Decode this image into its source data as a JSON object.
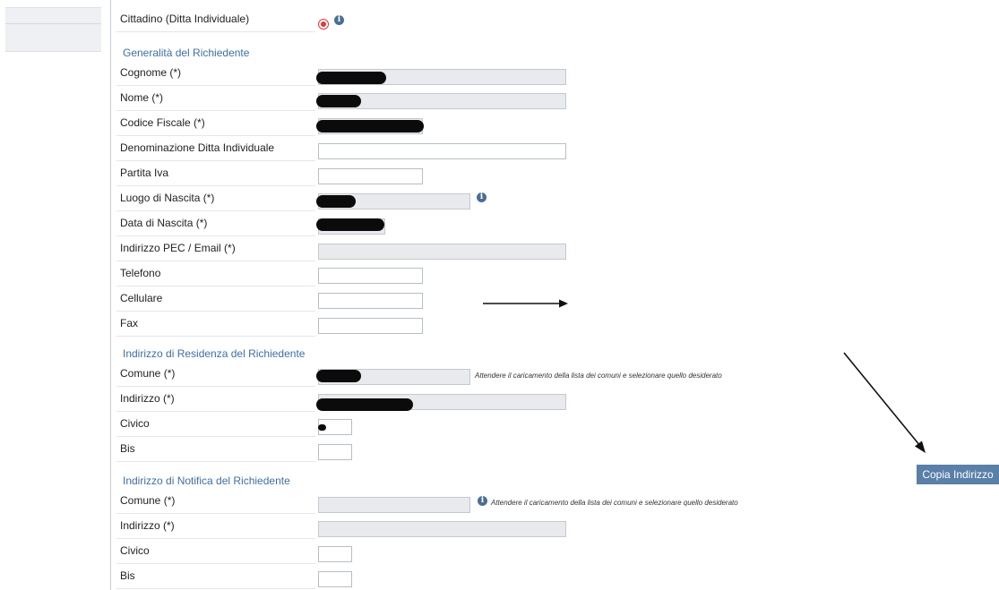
{
  "top_row": {
    "label": "Cittadino (Ditta Individuale)",
    "radio_selected": true
  },
  "sections": {
    "generalita": "Generalità del Richiedente",
    "residenza": "Indirizzo di Residenza del Richiedente",
    "notifica": "Indirizzo di Notifica del Richiedente"
  },
  "generalita_fields": [
    {
      "label": "Cognome (*)",
      "readonly": true,
      "redacted": true
    },
    {
      "label": "Nome (*)",
      "readonly": true,
      "redacted": true
    },
    {
      "label": "Codice Fiscale (*)",
      "readonly": true,
      "redacted": true
    },
    {
      "label": "Denominazione Ditta Individuale",
      "readonly": false,
      "value": ""
    },
    {
      "label": "Partita Iva",
      "readonly": false,
      "value": ""
    },
    {
      "label": "Luogo di Nascita (*)",
      "readonly": true,
      "redacted": true,
      "info_icon": true
    },
    {
      "label": "Data di Nascita (*)",
      "readonly": true,
      "redacted": true
    },
    {
      "label": "Indirizzo PEC / Email (*)",
      "readonly": true,
      "value": ""
    },
    {
      "label": "Telefono",
      "readonly": false,
      "value": ""
    },
    {
      "label": "Cellulare",
      "readonly": false,
      "value": ""
    },
    {
      "label": "Fax",
      "readonly": false,
      "value": ""
    }
  ],
  "residenza_fields": [
    {
      "label": "Comune (*)",
      "readonly": true,
      "redacted": true
    },
    {
      "label": "Indirizzo (*)",
      "readonly": true,
      "redacted": true
    },
    {
      "label": "Civico",
      "readonly": false,
      "redacted": true
    },
    {
      "label": "Bis",
      "readonly": false,
      "value": ""
    }
  ],
  "notifica_fields": [
    {
      "label": "Comune (*)",
      "readonly": true,
      "value": "",
      "info_icon": true
    },
    {
      "label": "Indirizzo (*)",
      "readonly": true,
      "value": ""
    },
    {
      "label": "Civico",
      "readonly": false,
      "value": ""
    },
    {
      "label": "Bis",
      "readonly": false,
      "value": ""
    }
  ],
  "hints": {
    "residenza_comune": "Attendere il caricamento della lista dei comuni e selezionare quello desiderato",
    "notifica_comune": "Attendere il caricamento della lista dei comuni e selezionare quello desiderato"
  },
  "copy_button_label": "Copia Indirizzo",
  "colors": {
    "section_title": "#3f6fa0",
    "button_bg": "#5a7fa8",
    "radio": "#e03a3a",
    "readonly_field": "#e8eaed"
  },
  "icons": [
    "radio-selected-icon",
    "info-icon",
    "arrow-right-icon",
    "arrow-down-right-icon"
  ]
}
